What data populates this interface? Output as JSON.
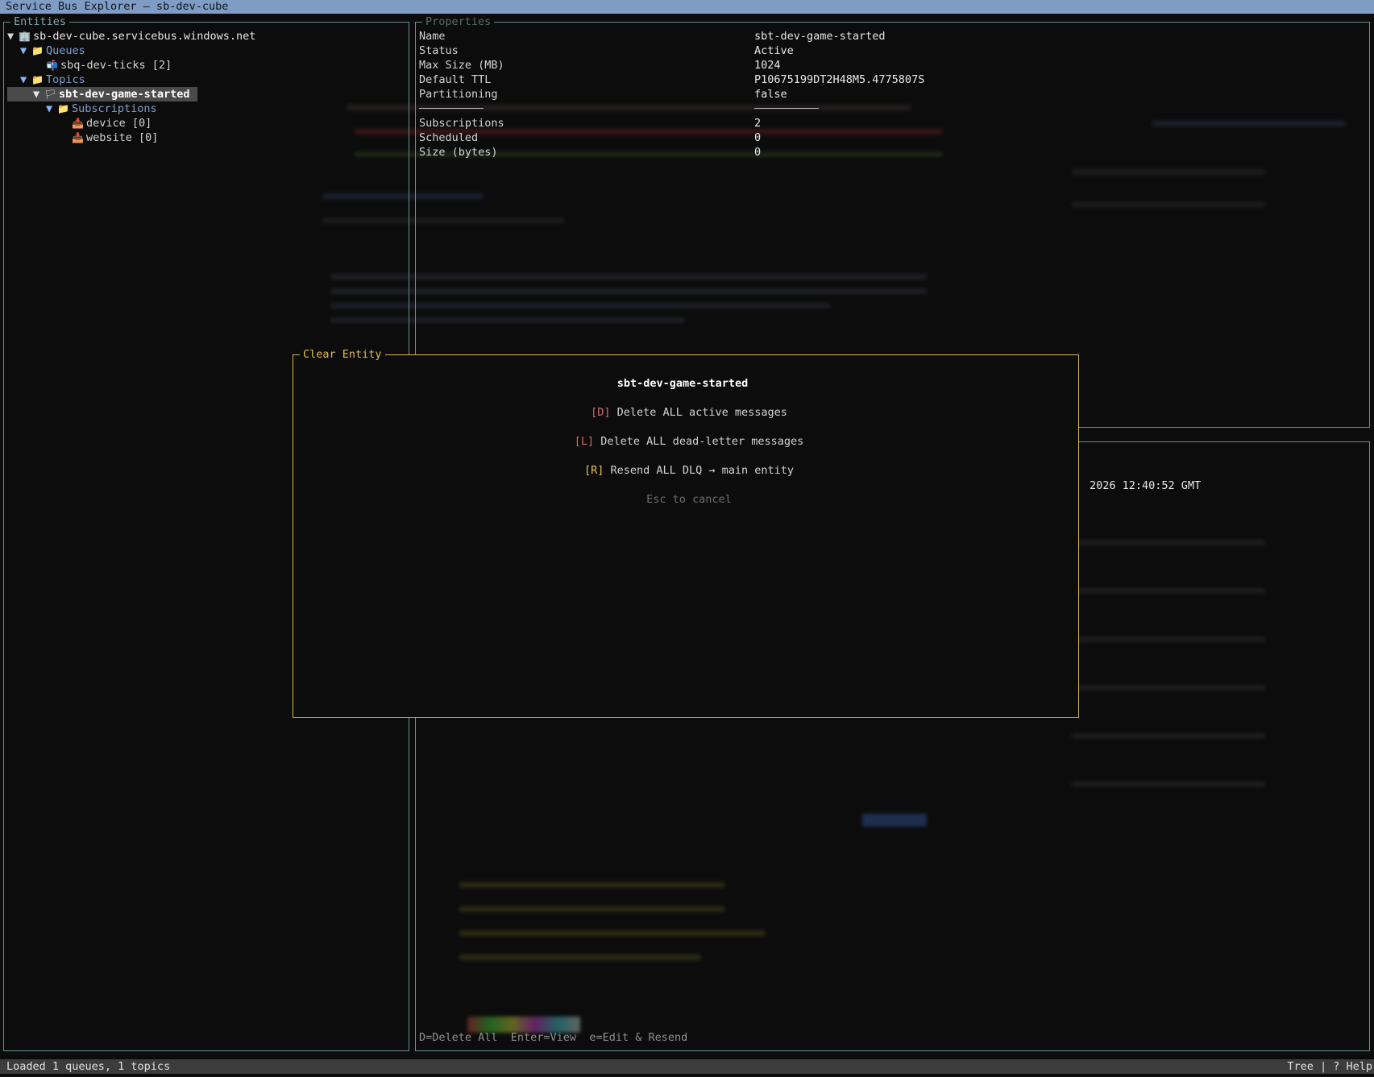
{
  "window": {
    "title": "Service Bus Explorer — sb-dev-cube"
  },
  "entities_panel": {
    "title": "Entities",
    "tree": {
      "namespace": "sb-dev-cube.servicebus.windows.net",
      "queues_label": "Queues",
      "queue_item": "sbq-dev-ticks [2]",
      "topics_label": "Topics",
      "topic_item": "sbt-dev-game-started",
      "subscriptions_label": "Subscriptions",
      "sub_device": "device [0]",
      "sub_website": "website [0]"
    }
  },
  "properties_panel": {
    "title": "Properties",
    "rows": [
      {
        "key": "Name",
        "value": "sbt-dev-game-started"
      },
      {
        "key": "Status",
        "value": "Active"
      },
      {
        "key": "Max Size (MB)",
        "value": "1024"
      },
      {
        "key": "Default TTL",
        "value": "P10675199DT2H48M5.4775807S"
      },
      {
        "key": "Partitioning",
        "value": "false"
      },
      {
        "key": "Subscriptions",
        "value": "2"
      },
      {
        "key": "Scheduled",
        "value": "0"
      },
      {
        "key": "Size (bytes)",
        "value": "0"
      }
    ]
  },
  "background_timestamp": "2026 12:40:52 GMT",
  "messages_hint": "D=Delete All  Enter=View  e=Edit & Resend",
  "dialog": {
    "title": "Clear Entity",
    "entity_name": "sbt-dev-game-started",
    "option_d_key": "[D]",
    "option_d_label": "Delete ALL active messages",
    "option_l_key": "[L]",
    "option_l_label": "Delete ALL dead-letter messages",
    "option_r_key": "[R]",
    "option_r_label": "Resend ALL DLQ → main entity",
    "cancel_hint": "Esc to cancel"
  },
  "status_bar": {
    "left": "Loaded 1 queues, 1 topics",
    "right": "Tree | ? Help"
  },
  "colors": {
    "title_bar": "#7f9cc4",
    "panel_border": "#6b8f90",
    "dialog_border": "#d9b84a",
    "key_red": "#d7686a",
    "key_yellow": "#e8c35a",
    "folder_blue": "#7fa0d0"
  }
}
